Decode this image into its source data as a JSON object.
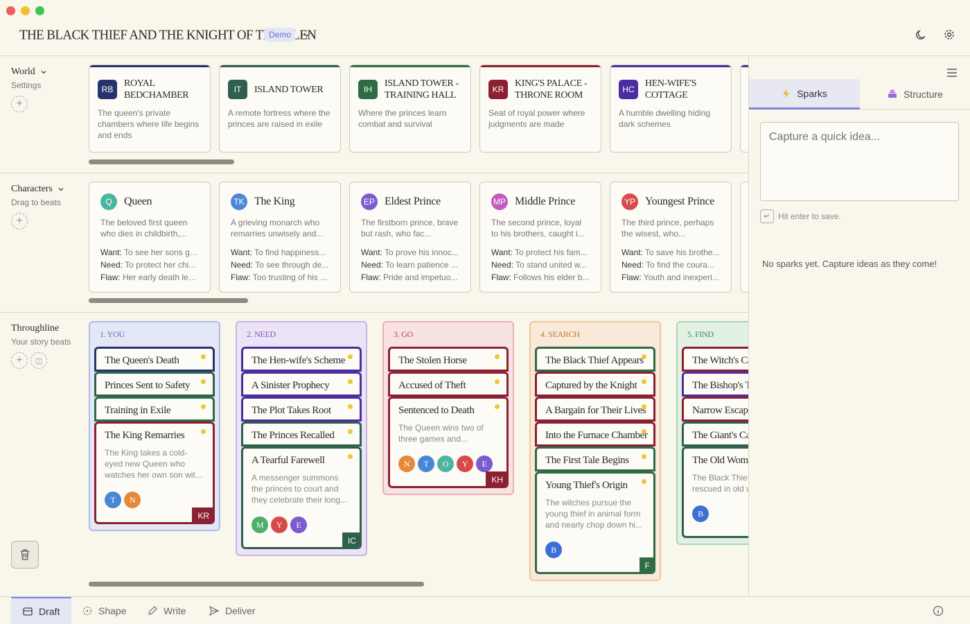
{
  "colors": {
    "accent": "#7d84d6",
    "background": "#f9f6ec",
    "card": "#fdfbf5",
    "beat_dot": "#e8c93a"
  },
  "titlebar": {
    "title": "THE BLACK THIEF AND THE KNIGHT OF THE GLEN",
    "badge": "Demo",
    "icons": [
      "chevron-down-icon",
      "moon-icon",
      "gear-icon"
    ]
  },
  "world": {
    "label": "World",
    "sublabel": "Settings",
    "items": [
      {
        "initials": "RB",
        "title": "ROYAL BEDCHAMBER",
        "desc": "The queen's private chambers where life begins and ends",
        "color": "#27336e"
      },
      {
        "initials": "IT",
        "title": "ISLAND TOWER",
        "desc": "A remote fortress where the princes are raised in exile",
        "color": "#2f5f4e"
      },
      {
        "initials": "IH",
        "title": "ISLAND TOWER - TRAINING HALL",
        "desc": "Where the princes learn combat and survival",
        "color": "#2f6b43"
      },
      {
        "initials": "KR",
        "title": "KING'S PALACE - THRONE ROOM",
        "desc": "Seat of royal power where judgments are made",
        "color": "#8c2033"
      },
      {
        "initials": "HC",
        "title": "HEN-WIFE'S COTTAGE",
        "desc": "A humble dwelling hiding dark schemes",
        "color": "#4b2da0"
      }
    ]
  },
  "characters": {
    "label": "Characters",
    "sublabel": "Drag to beats",
    "want_label": "Want:",
    "need_label": "Need:",
    "flaw_label": "Flaw:",
    "items": [
      {
        "initials": "Q",
        "name": "Queen",
        "color": "#4bb5a2",
        "desc": "The beloved first queen who dies in childbirth,...",
        "want": "To see her sons gr...",
        "need": "To protect her chi...",
        "flaw": "Her early death lea..."
      },
      {
        "initials": "TK",
        "name": "The King",
        "color": "#4a86d8",
        "desc": "A grieving monarch who remarries unwisely and...",
        "want": "To find happiness...",
        "need": "To see through de...",
        "flaw": "Too trusting of his ..."
      },
      {
        "initials": "EP",
        "name": "Eldest Prince",
        "color": "#7b5ccf",
        "desc": "The firstborn prince, brave but rash, who fac...",
        "want": "To prove his innoc...",
        "need": "To learn patience ...",
        "flaw": "Pride and impetuo..."
      },
      {
        "initials": "MP",
        "name": "Middle Prince",
        "color": "#c25bbd",
        "desc": "The second prince, loyal to his brothers, caught i...",
        "want": "To protect his fam...",
        "need": "To stand united w...",
        "flaw": "Follows his elder b..."
      },
      {
        "initials": "YP",
        "name": "Youngest Prince",
        "color": "#d64a4a",
        "desc": "The third prince, perhaps the wisest, who...",
        "want": "To save his brothe...",
        "need": "To find the coura...",
        "flaw": "Youth and inexperi..."
      }
    ]
  },
  "throughline": {
    "label": "Throughline",
    "sublabel": "Your story beats",
    "columns": [
      {
        "title": "1. YOU",
        "bg": "#e3e7f6",
        "border": "#aebde8",
        "titleColor": "#5b6bb8",
        "beatBorder": "#27336e",
        "beats": [
          "The Queen's Death",
          "Princes Sent to Safety",
          "Training in Exile"
        ],
        "open": {
          "title": "The King Remarries",
          "desc": "The King takes a cold-eyed new Queen who watches her own son wit...",
          "avatars": [
            {
              "l": "T",
              "c": "#4a86d8"
            },
            {
              "l": "N",
              "c": "#e58a3a"
            }
          ],
          "badge": "KR",
          "badgeColor": "#8c2033"
        },
        "beatColors": [
          "#27336e",
          "#2f5f4e",
          "#2f6b43",
          "#8c2033"
        ]
      },
      {
        "title": "2. NEED",
        "bg": "#ece4f6",
        "border": "#c5b4e6",
        "titleColor": "#7a56c0",
        "beats": [
          "The Hen-wife's Scheme",
          "A Sinister Prophecy",
          "The Plot Takes Root",
          "The Princes Recalled"
        ],
        "open": {
          "title": "A Tearful Farewell",
          "desc": "A messenger summons the princes to court and they celebrate their long...",
          "avatars": [
            {
              "l": "M",
              "c": "#4caf6a"
            },
            {
              "l": "Y",
              "c": "#d64a4a"
            },
            {
              "l": "E",
              "c": "#7b5ccf"
            }
          ],
          "badge": "IC",
          "badgeColor": "#2f5f4e"
        },
        "beatColors": [
          "#4b2da0",
          "#4b2da0",
          "#4b2da0",
          "#2f5f4e",
          "#2f5f4e"
        ]
      },
      {
        "title": "3. GO",
        "bg": "#f8e2e2",
        "border": "#eab0b0",
        "titleColor": "#b0444e",
        "beats": [
          "The Stolen Horse",
          "Accused of Theft"
        ],
        "open": {
          "title": "Sentenced to Death",
          "desc": "The Queen wins two of three games and...",
          "avatars": [
            {
              "l": "N",
              "c": "#e58a3a"
            },
            {
              "l": "T",
              "c": "#4a86d8"
            },
            {
              "l": "O",
              "c": "#4bb5a2"
            },
            {
              "l": "Y",
              "c": "#d64a4a"
            },
            {
              "l": "E",
              "c": "#7b5ccf"
            }
          ],
          "badge": "KH",
          "badgeColor": "#8c2033"
        },
        "beatColors": [
          "#8c2033",
          "#8c2033",
          "#8c2033"
        ]
      },
      {
        "title": "4. SEARCH",
        "bg": "#f8e9d8",
        "border": "#efc79a",
        "titleColor": "#c07a2a",
        "beats": [
          "The Black Thief Appears",
          "Captured by the Knight",
          "A Bargain for Their Lives",
          "Into the Furnace Chamber",
          "The First Tale Begins"
        ],
        "open": {
          "title": "Young Thief's Origin",
          "desc": "The witches pursue the young thief in animal form and nearly chop down hi...",
          "avatars": [
            {
              "l": "B",
              "c": "#3c6fd6"
            }
          ],
          "badge": "F",
          "badgeColor": "#2f6b43"
        },
        "beatColors": [
          "#2f6b43",
          "#8c2033",
          "#8c2033",
          "#8c2033",
          "#2f6b43",
          "#2f6b43"
        ]
      },
      {
        "title": "5. FIND",
        "bg": "#e2f1e4",
        "border": "#a9d7b0",
        "titleColor": "#3f8a52",
        "beats": [
          "The Witch's Cave",
          "The Bishop's Tale",
          "Narrow Escape",
          "The Giant's Castle"
        ],
        "open": {
          "title": "The Old Woman",
          "desc": "The Black Thief the rescued in old woman for...",
          "avatars": [
            {
              "l": "B",
              "c": "#3c6fd6"
            }
          ],
          "badge": "",
          "badgeColor": "#2f6b43"
        },
        "beatColors": [
          "#8c2033",
          "#4b2da0",
          "#8c2033",
          "#2f5f4e",
          "#2f5f4e"
        ]
      }
    ]
  },
  "panel": {
    "tabs": [
      {
        "label": "Sparks",
        "icon": "lightning-icon"
      },
      {
        "label": "Structure",
        "icon": "stack-icon"
      }
    ],
    "input_placeholder": "Capture a quick idea...",
    "hint": "Hit enter to save.",
    "empty": "No sparks yet. Capture ideas as they come!"
  },
  "bottom": {
    "tabs": [
      {
        "label": "Draft",
        "icon": "archive-icon"
      },
      {
        "label": "Shape",
        "icon": "shape-icon"
      },
      {
        "label": "Write",
        "icon": "pencil-icon"
      },
      {
        "label": "Deliver",
        "icon": "send-icon"
      }
    ]
  }
}
